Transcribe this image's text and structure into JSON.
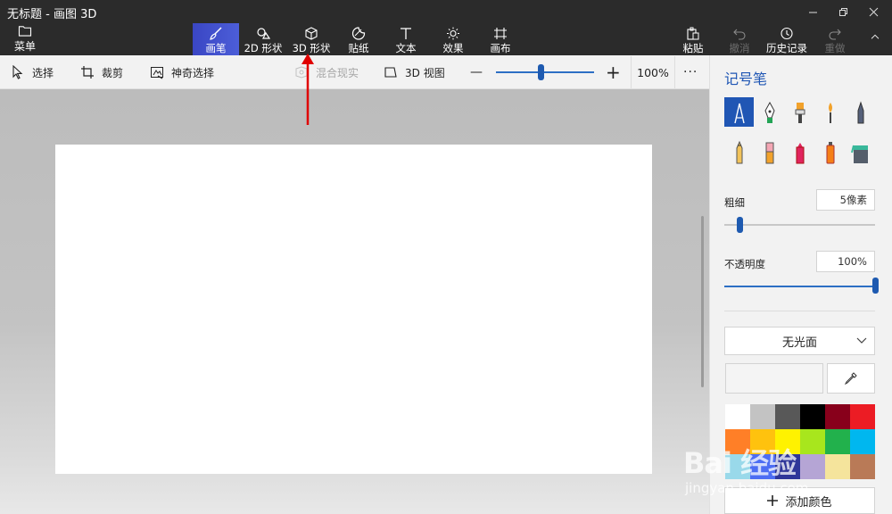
{
  "window": {
    "title": "无标题 - 画图 3D"
  },
  "ribbon": {
    "menu_label": "菜单",
    "tools": [
      {
        "label": "画笔",
        "icon": "brush-icon",
        "active": true
      },
      {
        "label": "2D 形状",
        "icon": "shapes-2d-icon"
      },
      {
        "label": "3D 形状",
        "icon": "cube-icon"
      },
      {
        "label": "贴纸",
        "icon": "sticker-icon"
      },
      {
        "label": "文本",
        "icon": "text-icon"
      },
      {
        "label": "效果",
        "icon": "effects-sun-icon"
      },
      {
        "label": "画布",
        "icon": "canvas-crop-icon"
      }
    ],
    "right_tools": [
      {
        "label": "粘贴",
        "icon": "paste-icon",
        "enabled": true
      },
      {
        "label": "撤消",
        "icon": "undo-icon",
        "enabled": false
      },
      {
        "label": "历史记录",
        "icon": "history-icon",
        "enabled": true
      },
      {
        "label": "重做",
        "icon": "redo-icon",
        "enabled": false
      }
    ]
  },
  "toolbar": {
    "select_label": "选择",
    "crop_label": "裁剪",
    "magic_select_label": "神奇选择",
    "mixed_reality_label": "混合现实",
    "view3d_label": "3D 视图",
    "zoom_minus": "—",
    "zoom_plus": "+",
    "zoom_value": "100%",
    "zoom_level": 0.45,
    "more": "···"
  },
  "panel": {
    "title": "记号笔",
    "brushes": [
      "marker-icon",
      "calligraphy-pen-icon",
      "oil-brush-icon",
      "watercolor-icon",
      "pixel-pen-icon",
      "pencil-icon",
      "eraser-icon",
      "crayon-icon",
      "spray-can-icon",
      "fill-bucket-icon"
    ],
    "thickness_label": "粗细",
    "thickness_value": "5像素",
    "thickness_level": 0.05,
    "opacity_label": "不透明度",
    "opacity_value": "100%",
    "opacity_level": 1.0,
    "finish_label": "无光面",
    "add_color_label": "添加颜色",
    "palette": [
      "#ffffff",
      "#c3c3c3",
      "#585858",
      "#000000",
      "#88001b",
      "#ec1c24",
      "#ff7f27",
      "#ffc20e",
      "#fff200",
      "#a8e61d",
      "#22b14c",
      "#00b7ef",
      "#99d9ea",
      "#4d6df3",
      "#2f3699",
      "#b5a5d5",
      "#f5e49c",
      "#b97a57"
    ]
  },
  "watermark": {
    "text": "Bai 经验",
    "url": "jingyan.baidu.com"
  }
}
